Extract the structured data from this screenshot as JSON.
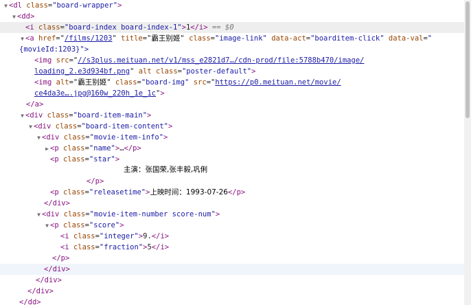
{
  "l0": {
    "open": "<dl",
    "attr": "class",
    "val": "\"board-wrapper\"",
    "close": ">"
  },
  "l1": {
    "open": "<dd>"
  },
  "l2": {
    "open": "<i",
    "attr": "class",
    "val": "\"board-index board-index-1\"",
    "close": ">",
    "text": "1",
    "end": "</i>",
    "eq": "==",
    "sel": "$0"
  },
  "l3": {
    "open": "<a",
    "href_attr": "href",
    "href_val": "/films/1203",
    "title_attr": "title",
    "title_val": "霸王别姬",
    "class_attr": "class",
    "class_val": "\"image-link\"",
    "act_attr": "data-act",
    "act_val": "\"boarditem-click\"",
    "dv_attr": "data-val",
    "dv_open": "\""
  },
  "l4": {
    "text": "{movieId:1203}\">"
  },
  "l5": {
    "open": "<img",
    "attr": "src",
    "link": "//s3plus.meituan.net/v1/mss_e2821d7…/cdn-prod/file:5788b470/image/"
  },
  "l6": {
    "link": "loading_2.e3d934bf.png",
    "alt": "alt",
    "class_attr": "class",
    "class_val": "\"poster-default\"",
    "close": ">"
  },
  "l7": {
    "open": "<img",
    "alt_attr": "alt",
    "alt_val": "霸王别姬",
    "class_attr": "class",
    "class_val": "\"board-img\"",
    "src_attr": "src",
    "link": "https://p0.meituan.net/movie/"
  },
  "l8": {
    "link": "ce4da3e….jpg@160w_220h_1e_1c",
    "close": ">"
  },
  "l9": {
    "tag": "</a>"
  },
  "l10": {
    "open": "<div",
    "attr": "class",
    "val": "\"board-item-main\"",
    "close": ">"
  },
  "l11": {
    "open": "<div",
    "attr": "class",
    "val": "\"board-item-content\"",
    "close": ">"
  },
  "l12": {
    "open": "<div",
    "attr": "class",
    "val": "\"movie-item-info\"",
    "close": ">"
  },
  "l13": {
    "open": "<p",
    "attr": "class",
    "val": "\"name\"",
    "close": ">",
    "text": "…",
    "end": "</p>"
  },
  "l14": {
    "open": "<p",
    "attr": "class",
    "val": "\"star\"",
    "close": ">"
  },
  "l15": {
    "text": "主演：张国荣,张丰毅,巩俐"
  },
  "l16": {
    "tag": "</p>"
  },
  "l17": {
    "open": "<p",
    "attr": "class",
    "val": "\"releasetime\"",
    "close": ">",
    "text": "上映时间：1993-07-26",
    "end": "</p>"
  },
  "l18": {
    "tag": "</div>"
  },
  "l19": {
    "open": "<div",
    "attr": "class",
    "val": "\"movie-item-number score-num\"",
    "close": ">"
  },
  "l20": {
    "open": "<p",
    "attr": "class",
    "val": "\"score\"",
    "close": ">"
  },
  "l21": {
    "open": "<i",
    "attr": "class",
    "val": "\"integer\"",
    "close": ">",
    "text": "9.",
    "end": "</i>"
  },
  "l22": {
    "open": "<i",
    "attr": "class",
    "val": "\"fraction\"",
    "close": ">",
    "text": "5",
    "end": "</i>"
  },
  "l23": {
    "tag": "</p>"
  },
  "l24": {
    "tag": "</div>"
  },
  "l25": {
    "tag": "</div>"
  },
  "l26": {
    "tag": "</div>"
  },
  "l27": {
    "tag": "</dd>"
  },
  "icons": {
    "expanded": "triangle-down",
    "collapsed": "triangle-right"
  }
}
